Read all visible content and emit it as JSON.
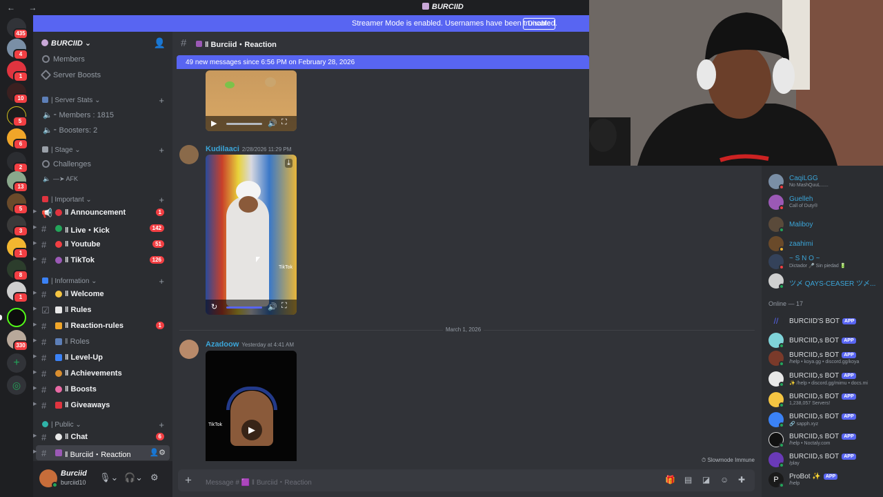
{
  "window": {
    "title": "BURCIID",
    "nav": "← →"
  },
  "streamer_bar": {
    "message": "Streamer Mode is enabled. Usernames have been truncated.",
    "disable_label": "Disable"
  },
  "rail": {
    "badges": [
      "435",
      "4",
      "1",
      "10",
      "5",
      "6",
      "2",
      "13",
      "5",
      "3",
      "1",
      "8",
      "1",
      "330",
      "1"
    ],
    "add_icon": "plus-icon",
    "explore_icon": "compass-icon"
  },
  "guild": {
    "name": "BURCIID"
  },
  "sidebar": {
    "top_items": [
      "Members",
      "Server Boosts"
    ],
    "server_stats": {
      "label": "| Server Stats",
      "items": [
        "⁃ Members : 1815",
        "⁃ Boosters: 2"
      ]
    },
    "stage": {
      "label": "| Stage",
      "items": [
        "Challenges",
        "—➤ AFK"
      ]
    },
    "important": {
      "label": "| Important",
      "channels": [
        {
          "name": "‖ Announcement",
          "count": "1"
        },
        {
          "name": "‖ Live・Kick",
          "count": "142"
        },
        {
          "name": "‖ Youtube",
          "count": "51"
        },
        {
          "name": "‖ TikTok",
          "count": "126"
        }
      ]
    },
    "information": {
      "label": "| Information",
      "channels": [
        {
          "name": "‖ Welcome",
          "count": ""
        },
        {
          "name": "‖ Rules",
          "count": ""
        },
        {
          "name": "‖ Reaction-rules",
          "count": "1"
        },
        {
          "name": "‖ Roles",
          "count": ""
        },
        {
          "name": "‖ Level-Up",
          "count": ""
        },
        {
          "name": "‖ Achievements",
          "count": ""
        },
        {
          "name": "‖ Boosts",
          "count": ""
        },
        {
          "name": "‖ Giveaways",
          "count": ""
        }
      ]
    },
    "public": {
      "label": "| Public",
      "channels": [
        {
          "name": "‖ Chat",
          "count": "6"
        },
        {
          "name": "‖ Burciid・Reaction",
          "count": ""
        }
      ]
    }
  },
  "user": {
    "name": "Burciid",
    "tag": "burciid10"
  },
  "channel": {
    "title": "‖ Burciid・Reaction"
  },
  "new_messages_bar": "49 new messages since 6:56 PM on February 28, 2026",
  "messages": [
    {
      "author": "Kudilaaci",
      "timestamp": "2/28/2026 11:29 PM",
      "author_color": "#3ba5d8"
    },
    {
      "author": "Azadoow",
      "timestamp": "Yesterday at 4:41 AM",
      "author_color": "#3ba5d8"
    }
  ],
  "date_divider": "March 1, 2026",
  "tiktok_watermark": "TikTok",
  "slowmode": "Slowmode Immune",
  "composer": {
    "placeholder": "Message # 🟪 ‖ Burciid・Reaction"
  },
  "members": {
    "top": [
      {
        "name": "CaqiLGG",
        "status": "No MashQuuL......"
      },
      {
        "name": "Guelleh",
        "status": "Call of Duty®"
      },
      {
        "name": "Maliboy",
        "status": ""
      },
      {
        "name": "zaahimi",
        "status": ""
      },
      {
        "name": "~ S N O ~",
        "status": "Dictador 🎤 Sin piedad 🔋"
      },
      {
        "name": "ツ〆 QAYS-CEASER ツ〆...",
        "status": ""
      }
    ],
    "online_header": "Online — 17",
    "bots": [
      {
        "name": "BURCIID'S BOT",
        "status": "",
        "tag": "APP"
      },
      {
        "name": "BURCIID,s BOT",
        "status": "",
        "tag": "APP"
      },
      {
        "name": "BURCIID,s BOT",
        "status": "/help • koya.gg • discord.gg/koya",
        "tag": "APP"
      },
      {
        "name": "BURCIID,s BOT",
        "status": "✨ /help • discord.gg/mimu • docs.mi",
        "tag": "APP"
      },
      {
        "name": "BURCIID,s BOT",
        "status": "1,238,057 Servers!",
        "tag": "APP"
      },
      {
        "name": "BURCIID,s BOT",
        "status": "🔗 sapph.xyz",
        "tag": "APP"
      },
      {
        "name": "BURCIID,s BOT",
        "status": "/help • Noctaly.com",
        "tag": "APP"
      },
      {
        "name": "BURCIID,s BOT",
        "status": "/play",
        "tag": "APP"
      },
      {
        "name": "ProBot ✨",
        "status": "/help",
        "tag": "APP"
      }
    ]
  },
  "colors": {
    "accent": "#5865f2",
    "badge": "#f23f43",
    "online": "#23a55a",
    "link": "#3ba5d8"
  }
}
